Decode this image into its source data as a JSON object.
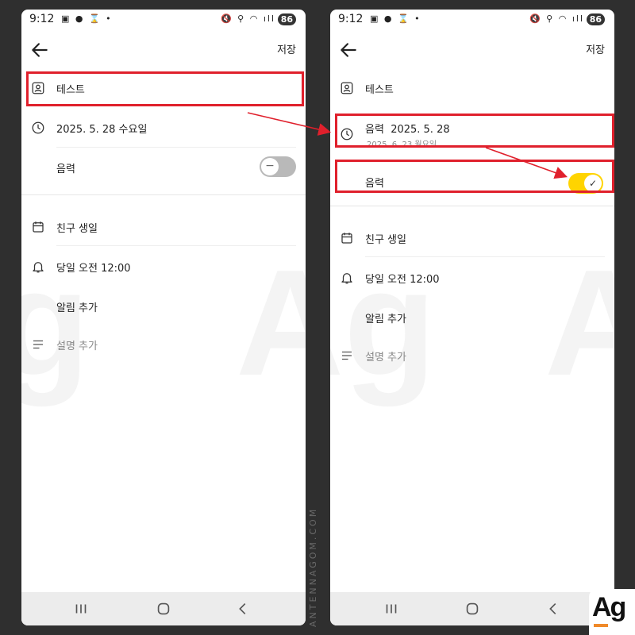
{
  "status": {
    "time": "9:12",
    "left_icons": "▣ ● ⌛ •",
    "right_icons": "🔇 ⚲ ◠ ıll",
    "battery": "86"
  },
  "header": {
    "save_label": "저장"
  },
  "left": {
    "title": "테스트",
    "date": "2025. 5. 28 수요일",
    "lunar_label": "음력",
    "lunar_toggle": "off",
    "category": "친구 생일",
    "alarm": "당일 오전 12:00",
    "add_alarm": "알림 추가",
    "add_description": "설명 추가"
  },
  "right": {
    "title": "테스트",
    "lunar_prefix": "음력",
    "date": "2025. 5. 28",
    "solar_date": "2025. 6. 23 월요일",
    "lunar_label": "음력",
    "lunar_toggle": "on",
    "category": "친구 생일",
    "alarm": "당일 오전 12:00",
    "add_alarm": "알림 추가",
    "add_description": "설명 추가"
  },
  "watermark": {
    "site": "ANTENNAGOM.COM",
    "logo": "Ag"
  },
  "colors": {
    "highlight": "#e0202c",
    "toggle_on": "#ffd400",
    "toggle_off": "#b9b9b9",
    "background": "#2f2f2f"
  }
}
